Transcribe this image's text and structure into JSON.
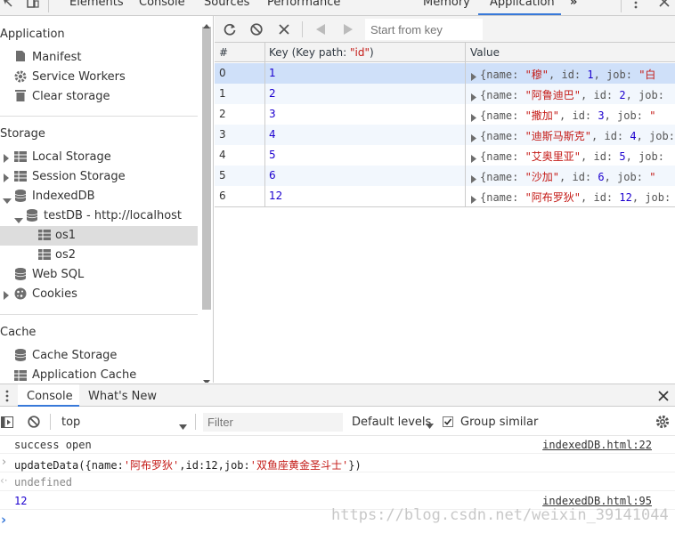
{
  "tabs": [
    "Elements",
    "Console",
    "Sources",
    "Performance",
    "Memory",
    "Application"
  ],
  "more_tabs": "»",
  "sidebar": {
    "application_header": "Application",
    "application_items": [
      "Manifest",
      "Service Workers",
      "Clear storage"
    ],
    "storage_header": "Storage",
    "storage_items": {
      "local_storage": "Local Storage",
      "session_storage": "Session Storage",
      "indexeddb": "IndexedDB",
      "testdb": "testDB - http://localhost",
      "os1": "os1",
      "os2": "os2",
      "websql": "Web SQL",
      "cookies": "Cookies"
    },
    "cache_header": "Cache",
    "cache_items": [
      "Cache Storage",
      "Application Cache"
    ]
  },
  "toolbar": {
    "start_placeholder": "Start from key"
  },
  "table": {
    "headers": [
      "#",
      "Key (Key path: ",
      "\"id\"",
      ")",
      "Value"
    ],
    "rows": [
      {
        "idx": "0",
        "key": "1",
        "name": "\"穆\"",
        "id": "1",
        "job": "\"白"
      },
      {
        "idx": "1",
        "key": "2",
        "name": "\"阿鲁迪巴\"",
        "id": "2",
        "job": ""
      },
      {
        "idx": "2",
        "key": "3",
        "name": "\"撒加\"",
        "id": "3",
        "job": "\""
      },
      {
        "idx": "3",
        "key": "4",
        "name": "\"迪斯马斯克\"",
        "id": "4",
        "job": ""
      },
      {
        "idx": "4",
        "key": "5",
        "name": "\"艾奥里亚\"",
        "id": "5",
        "job": ""
      },
      {
        "idx": "5",
        "key": "6",
        "name": "\"沙加\"",
        "id": "6",
        "job": "\""
      },
      {
        "idx": "6",
        "key": "12",
        "name": "\"阿布罗狄\"",
        "id": "12",
        "job": ""
      }
    ],
    "value_prefix": "{name: ",
    "value_id": ", id: ",
    "value_job": ", job: "
  },
  "drawer": {
    "tabs": [
      "Console",
      "What's New"
    ]
  },
  "console_bar": {
    "context": "top",
    "filter_placeholder": "Filter",
    "levels": "Default levels",
    "group_similar": "Group similar"
  },
  "console": {
    "lines": [
      {
        "text": "success open",
        "source": "indexedDB.html:22"
      },
      {
        "cmd_prefix": "updateData({name:",
        "cmd_name": "'阿布罗狄'",
        "cmd_mid": ",id:12,job:",
        "cmd_job": "'双鱼座黄金圣斗士'",
        "cmd_suffix": "})"
      },
      {
        "text": "undefined"
      },
      {
        "text": "12",
        "source": "indexedDB.html:95"
      }
    ],
    "prompt": "›"
  },
  "watermark": "https://blog.csdn.net/weixin_39141044",
  "colors": {
    "accent": "#3879d9",
    "selected_row": "#cfe0f9",
    "stripe": "#f2f7fd"
  }
}
